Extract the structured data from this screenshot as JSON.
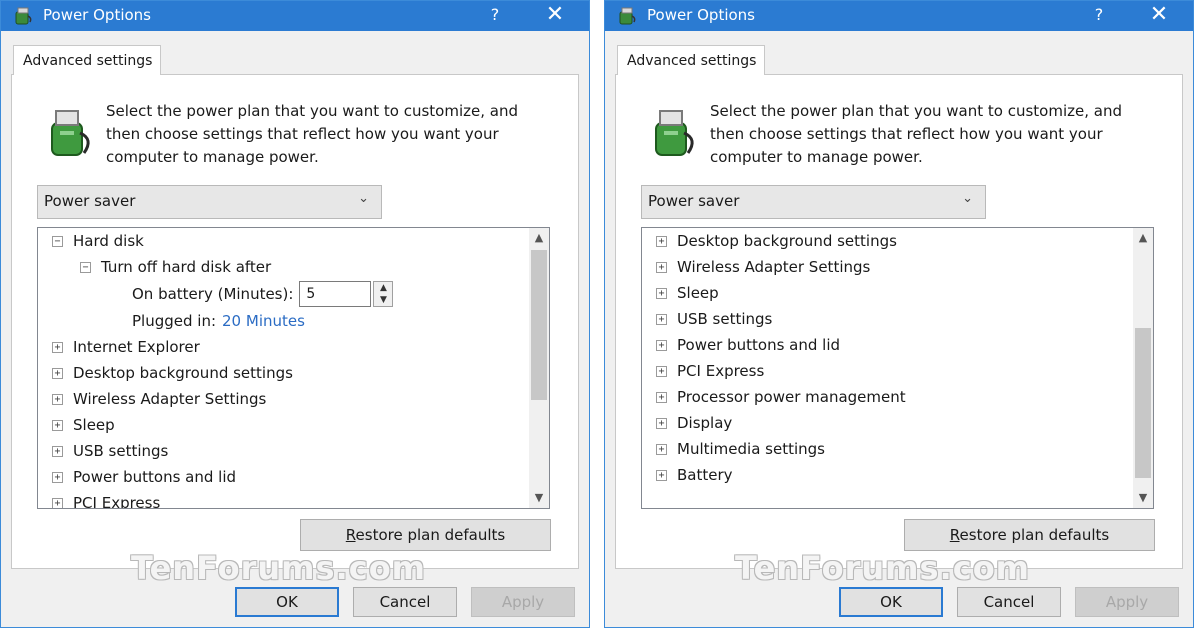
{
  "windows": [
    {
      "title": "Power Options",
      "help_label": "?",
      "close_label": "✕",
      "tab_label": "Advanced settings",
      "description": "Select the power plan that you want to customize, and then choose settings that reflect how you want your computer to manage power.",
      "plan_selected": "Power saver",
      "tree": {
        "hard_disk": "Hard disk",
        "turn_off": "Turn off hard disk after",
        "on_battery_label": "On battery (Minutes):",
        "on_battery_value": "5",
        "plugged_in_label": "Plugged in:",
        "plugged_in_value": "20 Minutes",
        "items": [
          "Internet Explorer",
          "Desktop background settings",
          "Wireless Adapter Settings",
          "Sleep",
          "USB settings",
          "Power buttons and lid",
          "PCI Express"
        ]
      },
      "restore_label_u": "R",
      "restore_label_rest": "estore plan defaults",
      "watermark": "TenForums.com",
      "ok_label": "OK",
      "cancel_label": "Cancel",
      "apply_label": "Apply"
    },
    {
      "title": "Power Options",
      "help_label": "?",
      "close_label": "✕",
      "tab_label": "Advanced settings",
      "description": "Select the power plan that you want to customize, and then choose settings that reflect how you want your computer to manage power.",
      "plan_selected": "Power saver",
      "tree": {
        "items": [
          "Desktop background settings",
          "Wireless Adapter Settings",
          "Sleep",
          "USB settings",
          "Power buttons and lid",
          "PCI Express",
          "Processor power management",
          "Display",
          "Multimedia settings",
          "Battery"
        ]
      },
      "restore_label_u": "R",
      "restore_label_rest": "estore plan defaults",
      "watermark": "TenForums.com",
      "ok_label": "OK",
      "cancel_label": "Cancel",
      "apply_label": "Apply"
    }
  ],
  "colors": {
    "titlebar": "#2b7bd2",
    "link": "#2b6cc4",
    "window_bg": "#f0f0f0"
  }
}
